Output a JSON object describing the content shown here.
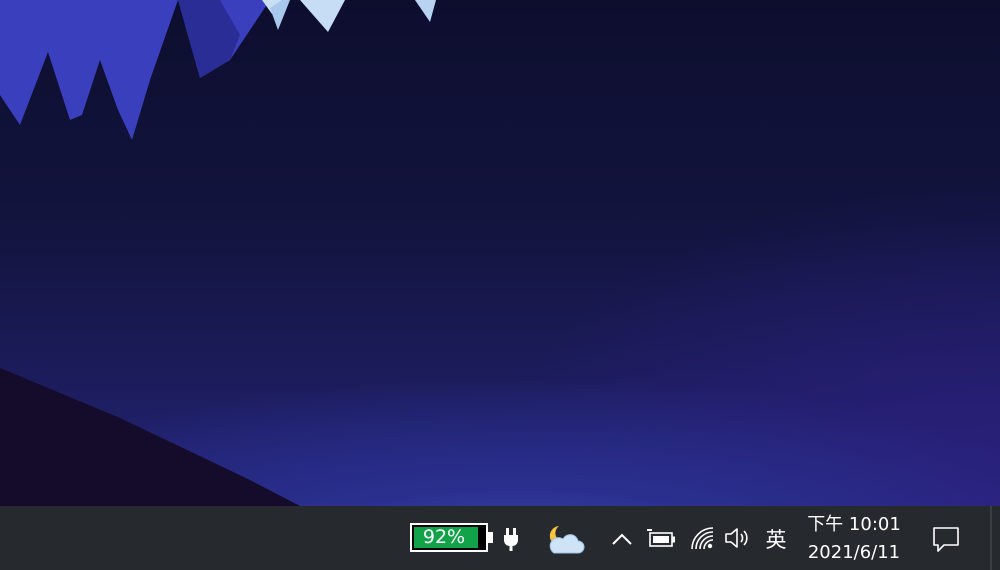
{
  "desktop": {
    "wallpaper": "night-mountain-landscape"
  },
  "taskbar": {
    "background_color": "#262a2e",
    "battery_meter": {
      "percent_label": "92%",
      "level": 0.92,
      "fill_color": "#12a24a"
    },
    "plug_icon": "plug-icon",
    "weather_icon": "moon-cloud-weather-icon",
    "tray_overflow_icon": "chevron-up-icon",
    "battery_status_icon": "battery-icon",
    "network_icon": "wifi-icon",
    "volume_icon": "speaker-icon",
    "input_method": "英",
    "clock": {
      "time": "下午 10:01",
      "date": "2021/6/11"
    },
    "notification_icon": "action-center-icon"
  }
}
